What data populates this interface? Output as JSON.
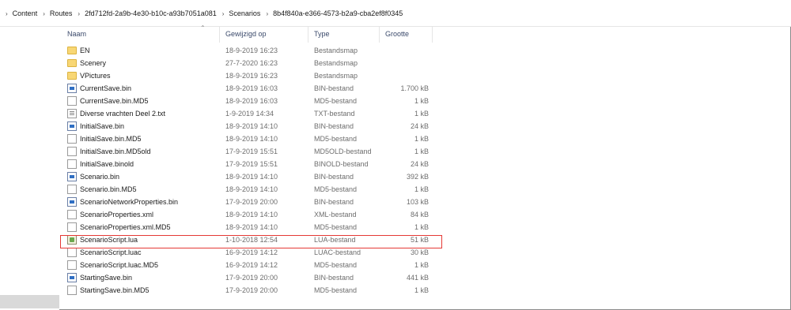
{
  "breadcrumb": [
    "Content",
    "Routes",
    "2fd712fd-2a9b-4e30-b10c-a93b7051a081",
    "Scenarios",
    "8b4f840a-e366-4573-b2a9-cba2ef8f0345"
  ],
  "columns": {
    "name": "Naam",
    "date": "Gewijzigd op",
    "type": "Type",
    "size": "Grootte"
  },
  "files": [
    {
      "name": "EN",
      "date": "18-9-2019 16:23",
      "type": "Bestandsmap",
      "size": "",
      "icon": "folder-icon"
    },
    {
      "name": "Scenery",
      "date": "27-7-2020 16:23",
      "type": "Bestandsmap",
      "size": "",
      "icon": "folder-icon"
    },
    {
      "name": "VPictures",
      "date": "18-9-2019 16:23",
      "type": "Bestandsmap",
      "size": "",
      "icon": "folder-icon"
    },
    {
      "name": "CurrentSave.bin",
      "date": "18-9-2019 16:03",
      "type": "BIN-bestand",
      "size": "1.700 kB",
      "icon": "bin-file-icon"
    },
    {
      "name": "CurrentSave.bin.MD5",
      "date": "18-9-2019 16:03",
      "type": "MD5-bestand",
      "size": "1 kB",
      "icon": "file-icon"
    },
    {
      "name": "Diverse vrachten Deel 2.txt",
      "date": "1-9-2019 14:34",
      "type": "TXT-bestand",
      "size": "1 kB",
      "icon": "text-file-icon"
    },
    {
      "name": "InitialSave.bin",
      "date": "18-9-2019 14:10",
      "type": "BIN-bestand",
      "size": "24 kB",
      "icon": "bin-file-icon"
    },
    {
      "name": "InitialSave.bin.MD5",
      "date": "18-9-2019 14:10",
      "type": "MD5-bestand",
      "size": "1 kB",
      "icon": "file-icon"
    },
    {
      "name": "InitialSave.bin.MD5old",
      "date": "17-9-2019 15:51",
      "type": "MD5OLD-bestand",
      "size": "1 kB",
      "icon": "file-icon"
    },
    {
      "name": "InitialSave.binold",
      "date": "17-9-2019 15:51",
      "type": "BINOLD-bestand",
      "size": "24 kB",
      "icon": "file-icon"
    },
    {
      "name": "Scenario.bin",
      "date": "18-9-2019 14:10",
      "type": "BIN-bestand",
      "size": "392 kB",
      "icon": "bin-file-icon"
    },
    {
      "name": "Scenario.bin.MD5",
      "date": "18-9-2019 14:10",
      "type": "MD5-bestand",
      "size": "1 kB",
      "icon": "file-icon"
    },
    {
      "name": "ScenarioNetworkProperties.bin",
      "date": "17-9-2019 20:00",
      "type": "BIN-bestand",
      "size": "103 kB",
      "icon": "bin-file-icon"
    },
    {
      "name": "ScenarioProperties.xml",
      "date": "18-9-2019 14:10",
      "type": "XML-bestand",
      "size": "84 kB",
      "icon": "file-icon"
    },
    {
      "name": "ScenarioProperties.xml.MD5",
      "date": "18-9-2019 14:10",
      "type": "MD5-bestand",
      "size": "1 kB",
      "icon": "file-icon"
    },
    {
      "name": "ScenarioScript.lua",
      "date": "1-10-2018 12:54",
      "type": "LUA-bestand",
      "size": "51 kB",
      "icon": "lua-file-icon"
    },
    {
      "name": "ScenarioScript.luac",
      "date": "16-9-2019 14:12",
      "type": "LUAC-bestand",
      "size": "30 kB",
      "icon": "file-icon"
    },
    {
      "name": "ScenarioScript.luac.MD5",
      "date": "16-9-2019 14:12",
      "type": "MD5-bestand",
      "size": "1 kB",
      "icon": "file-icon"
    },
    {
      "name": "StartingSave.bin",
      "date": "17-9-2019 20:00",
      "type": "BIN-bestand",
      "size": "441 kB",
      "icon": "bin-file-icon"
    },
    {
      "name": "StartingSave.bin.MD5",
      "date": "17-9-2019 20:00",
      "type": "MD5-bestand",
      "size": "1 kB",
      "icon": "file-icon"
    }
  ],
  "colors": {
    "highlight": "#e53935",
    "header_text": "#3b4a6b",
    "folder": "#f8d775"
  }
}
